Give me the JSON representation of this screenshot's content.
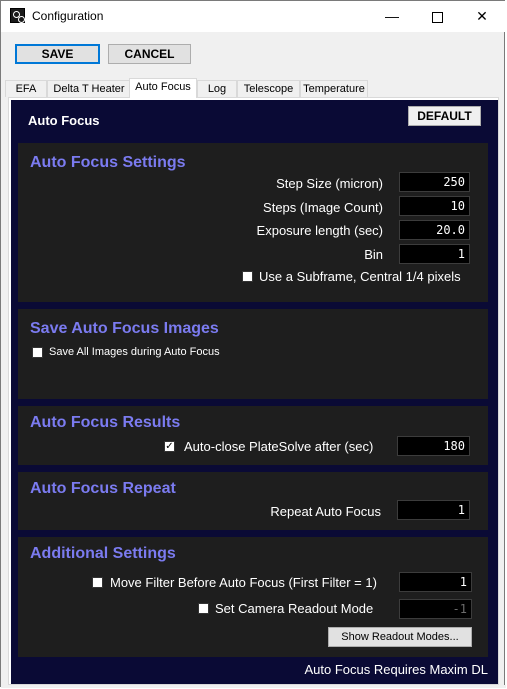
{
  "window": {
    "title": "Configuration",
    "minimize_glyph": "—",
    "close_glyph": "✕"
  },
  "toolbar": {
    "save_label": "SAVE",
    "cancel_label": "CANCEL"
  },
  "tabs": [
    {
      "label": "EFA",
      "active": false
    },
    {
      "label": "Delta T Heater",
      "active": false
    },
    {
      "label": "Auto Focus",
      "active": true
    },
    {
      "label": "Log",
      "active": false
    },
    {
      "label": "Telescope",
      "active": false
    },
    {
      "label": "Temperature",
      "active": false
    }
  ],
  "panel": {
    "title": "Auto Focus",
    "default_label": "DEFAULT",
    "footer": "Auto Focus Requires Maxim DL"
  },
  "settings": {
    "title": "Auto Focus Settings",
    "step_size_label": "Step Size (micron)",
    "step_size_value": "250",
    "steps_label": "Steps (Image Count)",
    "steps_value": "10",
    "exposure_label": "Exposure length (sec)",
    "exposure_value": "20.0",
    "bin_label": "Bin",
    "bin_value": "1",
    "subframe_label": "Use a Subframe, Central 1/4 pixels",
    "subframe_checked": false
  },
  "save_images": {
    "title": "Save Auto Focus Images",
    "save_all_label": "Save All Images during Auto Focus",
    "save_all_checked": false
  },
  "results": {
    "title": "Auto Focus Results",
    "autoclose_label": "Auto-close PlateSolve after (sec)",
    "autoclose_checked": true,
    "autoclose_value": "180"
  },
  "repeat": {
    "title": "Auto Focus Repeat",
    "repeat_label": "Repeat Auto Focus",
    "repeat_value": "1"
  },
  "additional": {
    "title": "Additional Settings",
    "move_filter_label": "Move Filter Before Auto Focus  (First Filter = 1)",
    "move_filter_checked": false,
    "move_filter_value": "1",
    "readout_label": "Set Camera Readout Mode",
    "readout_checked": false,
    "readout_value": "-1",
    "show_modes_label": "Show Readout Modes..."
  },
  "colors": {
    "panel_bg": "#0a0a35",
    "section_bg": "#1e1e1e",
    "section_title": "#7b7bf0",
    "save_border": "#0078d7"
  }
}
